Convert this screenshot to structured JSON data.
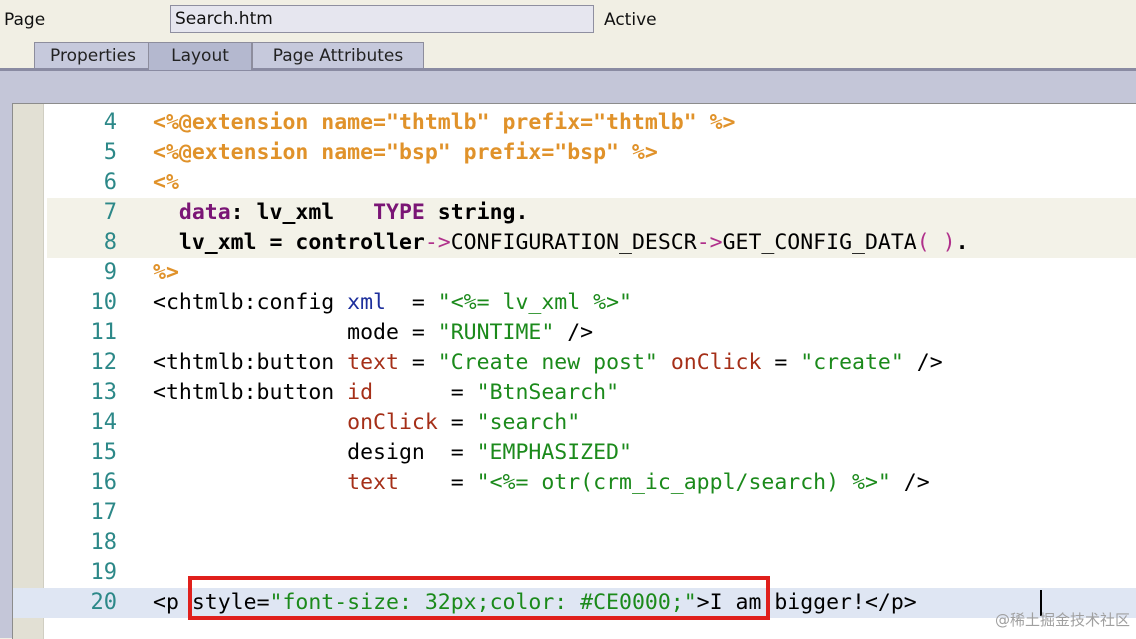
{
  "header": {
    "page_label": "Page",
    "page_value": "Search.htm",
    "status": "Active"
  },
  "tabs": [
    {
      "label": "Properties",
      "active": false
    },
    {
      "label": "Layout",
      "active": true
    },
    {
      "label": "Page Attributes",
      "active": false
    }
  ],
  "editor": {
    "current_line": 20,
    "lines": [
      {
        "num": "4",
        "tokens": [
          [
            "dir",
            "<%@extension name=\"thtmlb\" prefix=\"thtmlb\" %>"
          ]
        ]
      },
      {
        "num": "5",
        "tokens": [
          [
            "dir",
            "<%@extension name=\"bsp\" prefix=\"bsp\" %>"
          ]
        ]
      },
      {
        "num": "6",
        "tokens": [
          [
            "dir",
            "<%"
          ]
        ]
      },
      {
        "num": "7",
        "abap": true,
        "tokens": [
          [
            "plain",
            "  "
          ],
          [
            "kw",
            "data"
          ],
          [
            "abap",
            ": lv_xml   "
          ],
          [
            "kw2",
            "TYPE"
          ],
          [
            "abap",
            " string."
          ]
        ]
      },
      {
        "num": "8",
        "abap": true,
        "tokens": [
          [
            "plain",
            "  "
          ],
          [
            "abap",
            "lv_xml = controller"
          ],
          [
            "op",
            "->"
          ],
          [
            "plain",
            "CONFIGURATION_DESCR"
          ],
          [
            "op",
            "->"
          ],
          [
            "plain",
            "GET_CONFIG_DATA"
          ],
          [
            "op",
            "( )"
          ],
          [
            "abap",
            "."
          ]
        ]
      },
      {
        "num": "9",
        "tokens": [
          [
            "dir",
            "%>"
          ]
        ]
      },
      {
        "num": "10",
        "tokens": [
          [
            "tag",
            "<chtmlb:config "
          ],
          [
            "attr",
            "xml"
          ],
          [
            "tag",
            "  = "
          ],
          [
            "str",
            "\"<%= lv_xml %>\""
          ]
        ]
      },
      {
        "num": "11",
        "tokens": [
          [
            "tag",
            "               mode = "
          ],
          [
            "str",
            "\"RUNTIME\""
          ],
          [
            "tag",
            " />"
          ]
        ]
      },
      {
        "num": "12",
        "tokens": [
          [
            "tag",
            "<thtmlb:button "
          ],
          [
            "attr2",
            "text"
          ],
          [
            "tag",
            " = "
          ],
          [
            "str",
            "\"Create new post\""
          ],
          [
            "tag",
            " "
          ],
          [
            "attr2",
            "onClick"
          ],
          [
            "tag",
            " = "
          ],
          [
            "str",
            "\"create\""
          ],
          [
            "tag",
            " />"
          ]
        ]
      },
      {
        "num": "13",
        "tokens": [
          [
            "tag",
            "<thtmlb:button "
          ],
          [
            "attr2",
            "id"
          ],
          [
            "tag",
            "      = "
          ],
          [
            "str",
            "\"BtnSearch\""
          ]
        ]
      },
      {
        "num": "14",
        "tokens": [
          [
            "tag",
            "               "
          ],
          [
            "attr2",
            "onClick"
          ],
          [
            "tag",
            " = "
          ],
          [
            "str",
            "\"search\""
          ]
        ]
      },
      {
        "num": "15",
        "tokens": [
          [
            "tag",
            "               design  = "
          ],
          [
            "str",
            "\"EMPHASIZED\""
          ]
        ]
      },
      {
        "num": "16",
        "tokens": [
          [
            "tag",
            "               "
          ],
          [
            "attr2",
            "text"
          ],
          [
            "tag",
            "    = "
          ],
          [
            "str",
            "\"<%= otr(crm_ic_appl/search) %>\""
          ],
          [
            "tag",
            " />"
          ]
        ]
      },
      {
        "num": "17",
        "tokens": []
      },
      {
        "num": "18",
        "tokens": []
      },
      {
        "num": "19",
        "tokens": []
      },
      {
        "num": "20",
        "tokens": [
          [
            "tag",
            "<p "
          ],
          [
            "tag",
            "style="
          ],
          [
            "str",
            "\"font-size: 32px;color: #CE0000;\""
          ],
          [
            "tag",
            ">I am bigger!</p>"
          ]
        ]
      }
    ]
  },
  "watermark": "@稀土掘金技术社区"
}
